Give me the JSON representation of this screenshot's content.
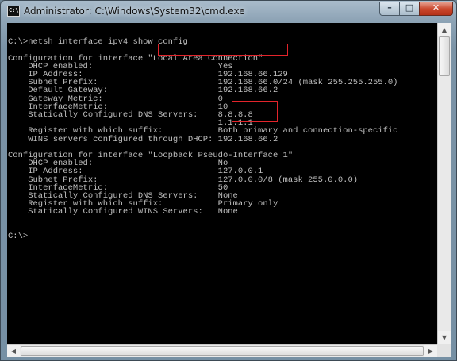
{
  "window": {
    "title": "Administrator: C:\\Windows\\System32\\cmd.exe",
    "icon_text": "C:\\",
    "controls": {
      "minimize": "–",
      "maximize": "□",
      "close": "✕"
    }
  },
  "console": {
    "lines": [
      "",
      "C:\\>netsh interface ipv4 show config",
      "",
      "Configuration for interface \"Local Area Connection\"",
      "    DHCP enabled:                         Yes",
      "    IP Address:                           192.168.66.129",
      "    Subnet Prefix:                        192.168.66.0/24 (mask 255.255.255.0)",
      "    Default Gateway:                      192.168.66.2",
      "    Gateway Metric:                       0",
      "    InterfaceMetric:                      10",
      "    Statically Configured DNS Servers:    8.8.8.8",
      "                                          1.1.1.1",
      "    Register with which suffix:           Both primary and connection-specific",
      "    WINS servers configured through DHCP: 192.168.66.2",
      "",
      "Configuration for interface \"Loopback Pseudo-Interface 1\"",
      "    DHCP enabled:                         No",
      "    IP Address:                           127.0.0.1",
      "    Subnet Prefix:                        127.0.0.0/8 (mask 255.0.0.0)",
      "    InterfaceMetric:                      50",
      "    Statically Configured DNS Servers:    None",
      "    Register with which suffix:           Primary only",
      "    Statically Configured WINS Servers:   None",
      "",
      "",
      "C:\\>"
    ]
  },
  "scrollbars": {
    "up": "▲",
    "down": "▼",
    "left": "◀",
    "right": "▶"
  },
  "colors": {
    "console_bg": "#000000",
    "console_text": "#c0c0c0",
    "highlight": "#e3242b",
    "close_button": "#c9472c"
  }
}
